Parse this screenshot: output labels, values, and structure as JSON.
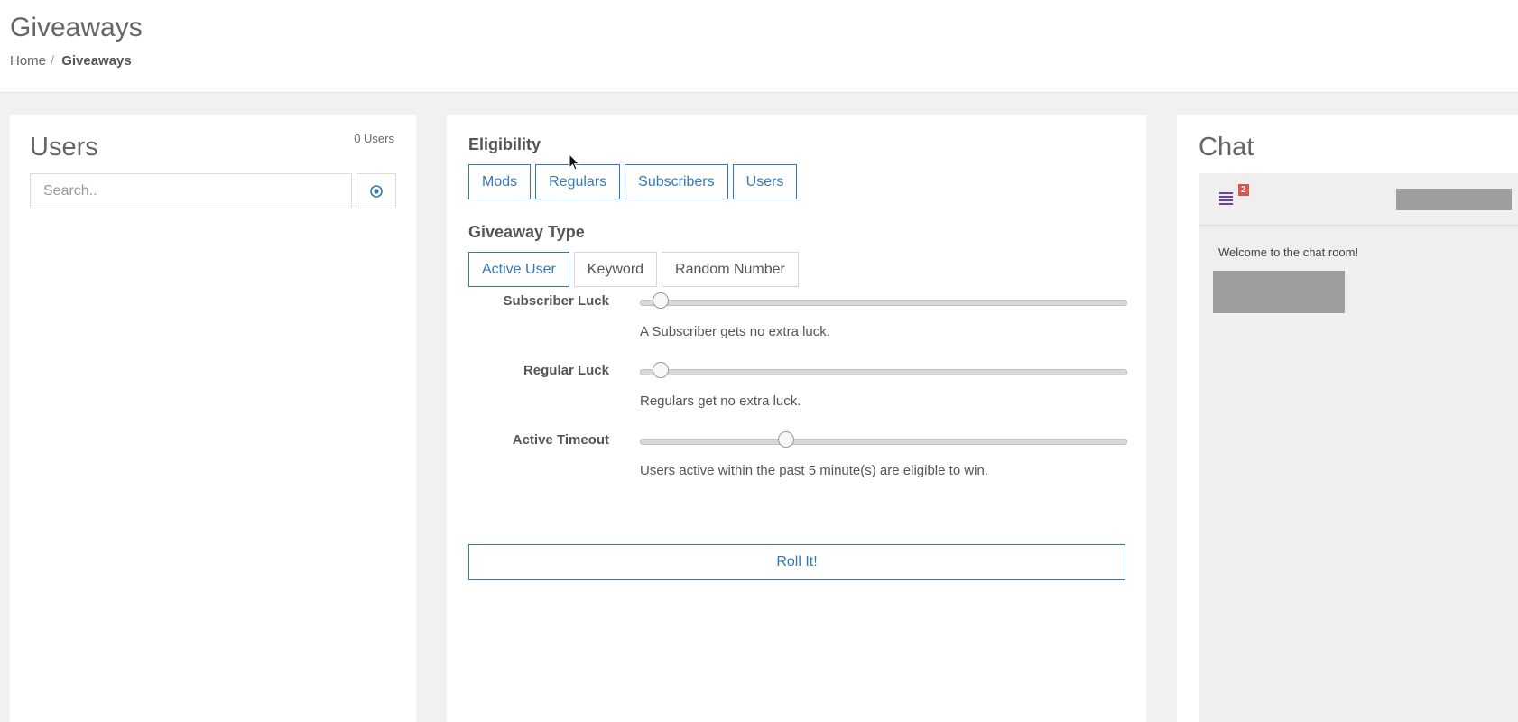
{
  "header": {
    "title": "Giveaways",
    "breadcrumb": {
      "home": "Home",
      "separator": "/",
      "current": "Giveaways"
    }
  },
  "users_panel": {
    "title": "Users",
    "count": "0 Users",
    "search": {
      "placeholder": "Search..",
      "value": ""
    },
    "target_icon": "target-icon"
  },
  "main": {
    "eligibility": {
      "label": "Eligibility",
      "options": [
        "Mods",
        "Regulars",
        "Subscribers",
        "Users"
      ],
      "selected": [
        "Mods",
        "Regulars",
        "Subscribers",
        "Users"
      ]
    },
    "giveaway_type": {
      "label": "Giveaway Type",
      "options": [
        "Active User",
        "Keyword",
        "Random Number"
      ],
      "selected": "Active User"
    },
    "sliders": [
      {
        "label": "Subscriber Luck",
        "position_fraction": 0.04,
        "help": "A Subscriber gets no extra luck."
      },
      {
        "label": "Regular Luck",
        "position_fraction": 0.04,
        "help": "Regulars get no extra luck."
      },
      {
        "label": "Active Timeout",
        "position_fraction": 0.3,
        "help": "Users active within the past 5 minute(s) are eligible to win."
      }
    ],
    "roll_button": "Roll It!"
  },
  "chat": {
    "title": "Chat",
    "list_icon": "list-icon",
    "badge": "2",
    "welcome": "Welcome to the chat room!"
  },
  "colors": {
    "accent": "#337ab7",
    "badge": "#d9534f",
    "list_icon": "#6a3fb2",
    "redacted": "#9e9e9e"
  }
}
